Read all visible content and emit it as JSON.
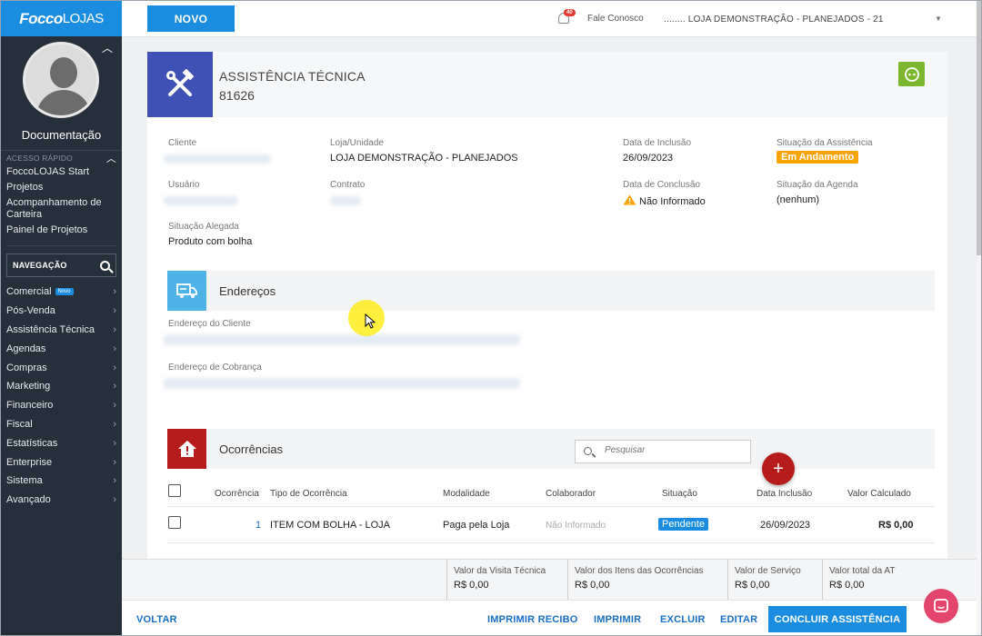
{
  "app": {
    "logo_bold": "Focco",
    "logo_thin": "LOJAS"
  },
  "sidebar": {
    "user_name": "Documentação",
    "quick_access_title": "ACESSO RÁPIDO",
    "quick_links": [
      "FoccoLOJAS Start",
      "Projetos",
      "Acompanhamento de Carteira",
      "Painel de Projetos"
    ],
    "nav_search_label": "NAVEGAÇÃO",
    "new_badge": "Novo",
    "nav_items": [
      "Comercial",
      "Pós-Venda",
      "Assistência Técnica",
      "Agendas",
      "Compras",
      "Marketing",
      "Financeiro",
      "Fiscal",
      "Estatísticas",
      "Enterprise",
      "Sistema",
      "Avançado"
    ]
  },
  "topbar": {
    "new_button": "NOVO",
    "notifications_count": "40",
    "contact": "Fale Conosco",
    "store_selector": "........ LOJA DEMONSTRAÇÃO - PLANEJADOS - 21"
  },
  "header": {
    "title": "ASSISTÊNCIA TÉCNICA",
    "number": "81626"
  },
  "details": {
    "cliente_label": "Cliente",
    "loja_label": "Loja/Unidade",
    "loja_value": "LOJA DEMONSTRAÇÃO - PLANEJADOS",
    "data_inclusao_label": "Data de Inclusão",
    "data_inclusao_value": "26/09/2023",
    "situacao_assist_label": "Situação da Assistência",
    "situacao_assist_value": "Em Andamento",
    "usuario_label": "Usuário",
    "contrato_label": "Contrato",
    "data_conclusao_label": "Data de Conclusão",
    "data_conclusao_value": "Não Informado",
    "situacao_agenda_label": "Situação da Agenda",
    "situacao_agenda_value": "(nenhum)",
    "situacao_alegada_label": "Situação Alegada",
    "situacao_alegada_value": "Produto com bolha"
  },
  "enderecos": {
    "title": "Endereços",
    "cliente_label": "Endereço do Cliente",
    "cobranca_label": "Endereço de Cobrança"
  },
  "ocorrencias": {
    "title": "Ocorrências",
    "search_placeholder": "Pesquisar",
    "add_symbol": "+",
    "columns": [
      "Ocorrência",
      "Tipo de Ocorrência",
      "Modalidade",
      "Colaborador",
      "Situação",
      "Data Inclusão",
      "Valor Calculado"
    ],
    "rows": [
      {
        "ocorrencia": "1",
        "tipo": "ITEM COM BOLHA - LOJA",
        "modalidade": "Paga pela Loja",
        "colaborador": "Não Informado",
        "situacao": "Pendente",
        "data": "26/09/2023",
        "valor": "R$ 0,00"
      }
    ]
  },
  "summary": [
    {
      "label": "Valor da Visita Técnica",
      "value": "R$ 0,00"
    },
    {
      "label": "Valor dos Itens das Ocorrências",
      "value": "R$ 0,00"
    },
    {
      "label": "Valor de Serviço",
      "value": "R$ 0,00"
    },
    {
      "label": "Valor total da AT",
      "value": "R$ 0,00"
    }
  ],
  "actions": {
    "voltar": "VOLTAR",
    "imprimir_recibo": "IMPRIMIR RECIBO",
    "imprimir": "IMPRIMIR",
    "excluir": "EXCLUIR",
    "editar": "EDITAR",
    "concluir": "CONCLUIR ASSISTÊNCIA"
  },
  "colors": {
    "primary": "#1a8de0",
    "sidebar": "#26303b",
    "header_icon": "#3f51b5",
    "status_orange": "#f9a400",
    "danger": "#b71c1c",
    "addresses_icon": "#4fb3e8"
  },
  "icons": {
    "header": "tools-icon",
    "addresses": "truck-icon",
    "occurrences": "warning-house-icon",
    "green_action": "robot-icon",
    "notifications": "bell-icon",
    "chat": "chat-icon"
  }
}
